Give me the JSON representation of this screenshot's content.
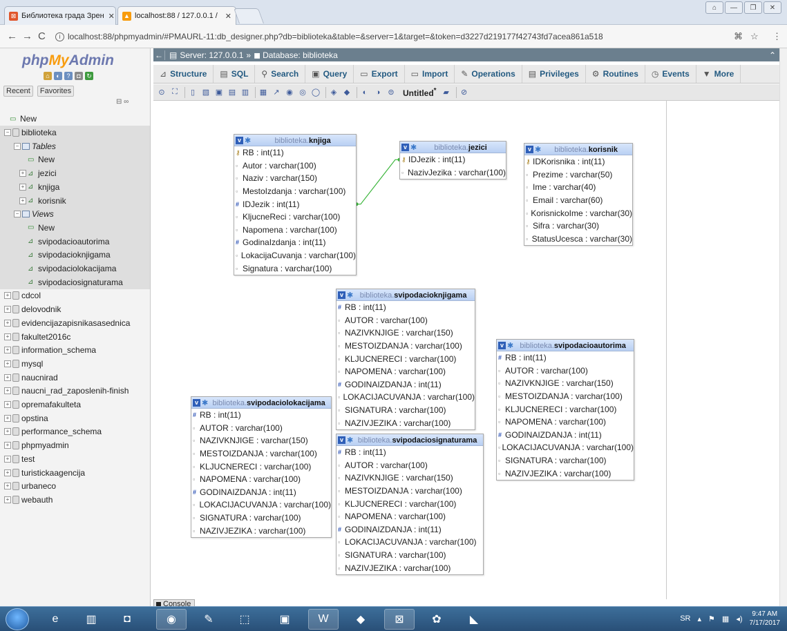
{
  "browser": {
    "tabs": [
      {
        "title": "Библиотека града Зрен",
        "active": false
      },
      {
        "title": "localhost:88 / 127.0.0.1 /",
        "active": true
      }
    ],
    "url": "localhost:88/phpmyadmin/#PMAURL-11:db_designer.php?db=biblioteka&table=&server=1&target=&token=d3227d219177f42743fd7acea861a518"
  },
  "pma": {
    "logo": {
      "part1": "php",
      "part2": "My",
      "part3": "Admin"
    },
    "recent_label": "Recent",
    "favorites_label": "Favorites",
    "tree": {
      "new_label": "New",
      "current_db": "biblioteka",
      "tables_label": "Tables",
      "tables_new": "New",
      "tables": [
        "jezici",
        "knjiga",
        "korisnik"
      ],
      "views_label": "Views",
      "views_new": "New",
      "views": [
        "svipodacioautorima",
        "svipodacioknjigama",
        "svipodaciolokacijama",
        "svipodaciosignaturama"
      ],
      "other_dbs": [
        "cdcol",
        "delovodnik",
        "evidencijazapisnikasasednica",
        "fakultet2016c",
        "information_schema",
        "mysql",
        "naucnirad",
        "naucni_rad_zaposlenih-finish",
        "opremafakulteta",
        "opstina",
        "performance_schema",
        "phpmyadmin",
        "test",
        "turistickaagencija",
        "urbaneco",
        "webauth"
      ]
    },
    "breadcrumb": {
      "server": "Server: 127.0.0.1",
      "sep": "»",
      "database": "Database: biblioteka"
    },
    "menu": [
      {
        "label": "Structure",
        "icon": "structure-icon"
      },
      {
        "label": "SQL",
        "icon": "sql-icon"
      },
      {
        "label": "Search",
        "icon": "search-icon"
      },
      {
        "label": "Query",
        "icon": "query-icon"
      },
      {
        "label": "Export",
        "icon": "export-icon"
      },
      {
        "label": "Import",
        "icon": "import-icon"
      },
      {
        "label": "Operations",
        "icon": "wrench-icon"
      },
      {
        "label": "Privileges",
        "icon": "privileges-icon"
      },
      {
        "label": "Routines",
        "icon": "routines-icon"
      },
      {
        "label": "Events",
        "icon": "clock-icon"
      },
      {
        "label": "More",
        "icon": "chevron-down-icon"
      }
    ],
    "designer_title": "Untitled",
    "designer_title_mark": "*",
    "console_label": "Console"
  },
  "designer_tables": [
    {
      "db": "biblioteka",
      "name": "knjiga",
      "columns": [
        {
          "text": "RB : int(11)",
          "kind": "key"
        },
        {
          "text": "Autor : varchar(100)",
          "kind": "text"
        },
        {
          "text": "Naziv : varchar(150)",
          "kind": "text"
        },
        {
          "text": "MestoIzdanja : varchar(100)",
          "kind": "text"
        },
        {
          "text": "IDJezik : int(11)",
          "kind": "num"
        },
        {
          "text": "KljucneReci : varchar(100)",
          "kind": "text"
        },
        {
          "text": "Napomena : varchar(100)",
          "kind": "text"
        },
        {
          "text": "GodinaIzdanja : int(11)",
          "kind": "num"
        },
        {
          "text": "LokacijaCuvanja : varchar(100)",
          "kind": "text"
        },
        {
          "text": "Signatura : varchar(100)",
          "kind": "text"
        }
      ]
    },
    {
      "db": "biblioteka",
      "name": "jezici",
      "columns": [
        {
          "text": "IDJezik : int(11)",
          "kind": "key"
        },
        {
          "text": "NazivJezika : varchar(100)",
          "kind": "text"
        }
      ]
    },
    {
      "db": "biblioteka",
      "name": "korisnik",
      "columns": [
        {
          "text": "IDKorisnika : int(11)",
          "kind": "key"
        },
        {
          "text": "Prezime : varchar(50)",
          "kind": "text"
        },
        {
          "text": "Ime : varchar(40)",
          "kind": "text"
        },
        {
          "text": "Email : varchar(60)",
          "kind": "text"
        },
        {
          "text": "KorisnickoIme : varchar(30)",
          "kind": "text"
        },
        {
          "text": "Sifra : varchar(30)",
          "kind": "text"
        },
        {
          "text": "StatusUcesca : varchar(30)",
          "kind": "text"
        }
      ]
    },
    {
      "db": "biblioteka",
      "name": "svipodacioknjigama",
      "columns": [
        {
          "text": "RB : int(11)",
          "kind": "num"
        },
        {
          "text": "AUTOR : varchar(100)",
          "kind": "text"
        },
        {
          "text": "NAZIVKNJIGE : varchar(150)",
          "kind": "text"
        },
        {
          "text": "MESTOIZDANJA : varchar(100)",
          "kind": "text"
        },
        {
          "text": "KLJUCNERECI : varchar(100)",
          "kind": "text"
        },
        {
          "text": "NAPOMENA : varchar(100)",
          "kind": "text"
        },
        {
          "text": "GODINAIZDANJA : int(11)",
          "kind": "num"
        },
        {
          "text": "LOKACIJACUVANJA : varchar(100)",
          "kind": "text"
        },
        {
          "text": "SIGNATURA : varchar(100)",
          "kind": "text"
        },
        {
          "text": "NAZIVJEZIKA : varchar(100)",
          "kind": "text"
        }
      ]
    },
    {
      "db": "biblioteka",
      "name": "svipodacioautorima",
      "columns": [
        {
          "text": "RB : int(11)",
          "kind": "num"
        },
        {
          "text": "AUTOR : varchar(100)",
          "kind": "text"
        },
        {
          "text": "NAZIVKNJIGE : varchar(150)",
          "kind": "text"
        },
        {
          "text": "MESTOIZDANJA : varchar(100)",
          "kind": "text"
        },
        {
          "text": "KLJUCNERECI : varchar(100)",
          "kind": "text"
        },
        {
          "text": "NAPOMENA : varchar(100)",
          "kind": "text"
        },
        {
          "text": "GODINAIZDANJA : int(11)",
          "kind": "num"
        },
        {
          "text": "LOKACIJACUVANJA : varchar(100)",
          "kind": "text"
        },
        {
          "text": "SIGNATURA : varchar(100)",
          "kind": "text"
        },
        {
          "text": "NAZIVJEZIKA : varchar(100)",
          "kind": "text"
        }
      ]
    },
    {
      "db": "biblioteka",
      "name": "svipodaciolokacijama",
      "columns": [
        {
          "text": "RB : int(11)",
          "kind": "num"
        },
        {
          "text": "AUTOR : varchar(100)",
          "kind": "text"
        },
        {
          "text": "NAZIVKNJIGE : varchar(150)",
          "kind": "text"
        },
        {
          "text": "MESTOIZDANJA : varchar(100)",
          "kind": "text"
        },
        {
          "text": "KLJUCNERECI : varchar(100)",
          "kind": "text"
        },
        {
          "text": "NAPOMENA : varchar(100)",
          "kind": "text"
        },
        {
          "text": "GODINAIZDANJA : int(11)",
          "kind": "num"
        },
        {
          "text": "LOKACIJACUVANJA : varchar(100)",
          "kind": "text"
        },
        {
          "text": "SIGNATURA : varchar(100)",
          "kind": "text"
        },
        {
          "text": "NAZIVJEZIKA : varchar(100)",
          "kind": "text"
        }
      ]
    },
    {
      "db": "biblioteka",
      "name": "svipodaciosignaturama",
      "columns": [
        {
          "text": "RB : int(11)",
          "kind": "num"
        },
        {
          "text": "AUTOR : varchar(100)",
          "kind": "text"
        },
        {
          "text": "NAZIVKNJIGE : varchar(150)",
          "kind": "text"
        },
        {
          "text": "MESTOIZDANJA : varchar(100)",
          "kind": "text"
        },
        {
          "text": "KLJUCNERECI : varchar(100)",
          "kind": "text"
        },
        {
          "text": "NAPOMENA : varchar(100)",
          "kind": "text"
        },
        {
          "text": "GODINAIZDANJA : int(11)",
          "kind": "num"
        },
        {
          "text": "LOKACIJACUVANJA : varchar(100)",
          "kind": "text"
        },
        {
          "text": "SIGNATURA : varchar(100)",
          "kind": "text"
        },
        {
          "text": "NAZIVJEZIKA : varchar(100)",
          "kind": "text"
        }
      ]
    }
  ],
  "relation_color": "#3ab53a",
  "taskbar": {
    "language": "SR",
    "time": "9:47 AM",
    "date": "7/17/2017"
  }
}
